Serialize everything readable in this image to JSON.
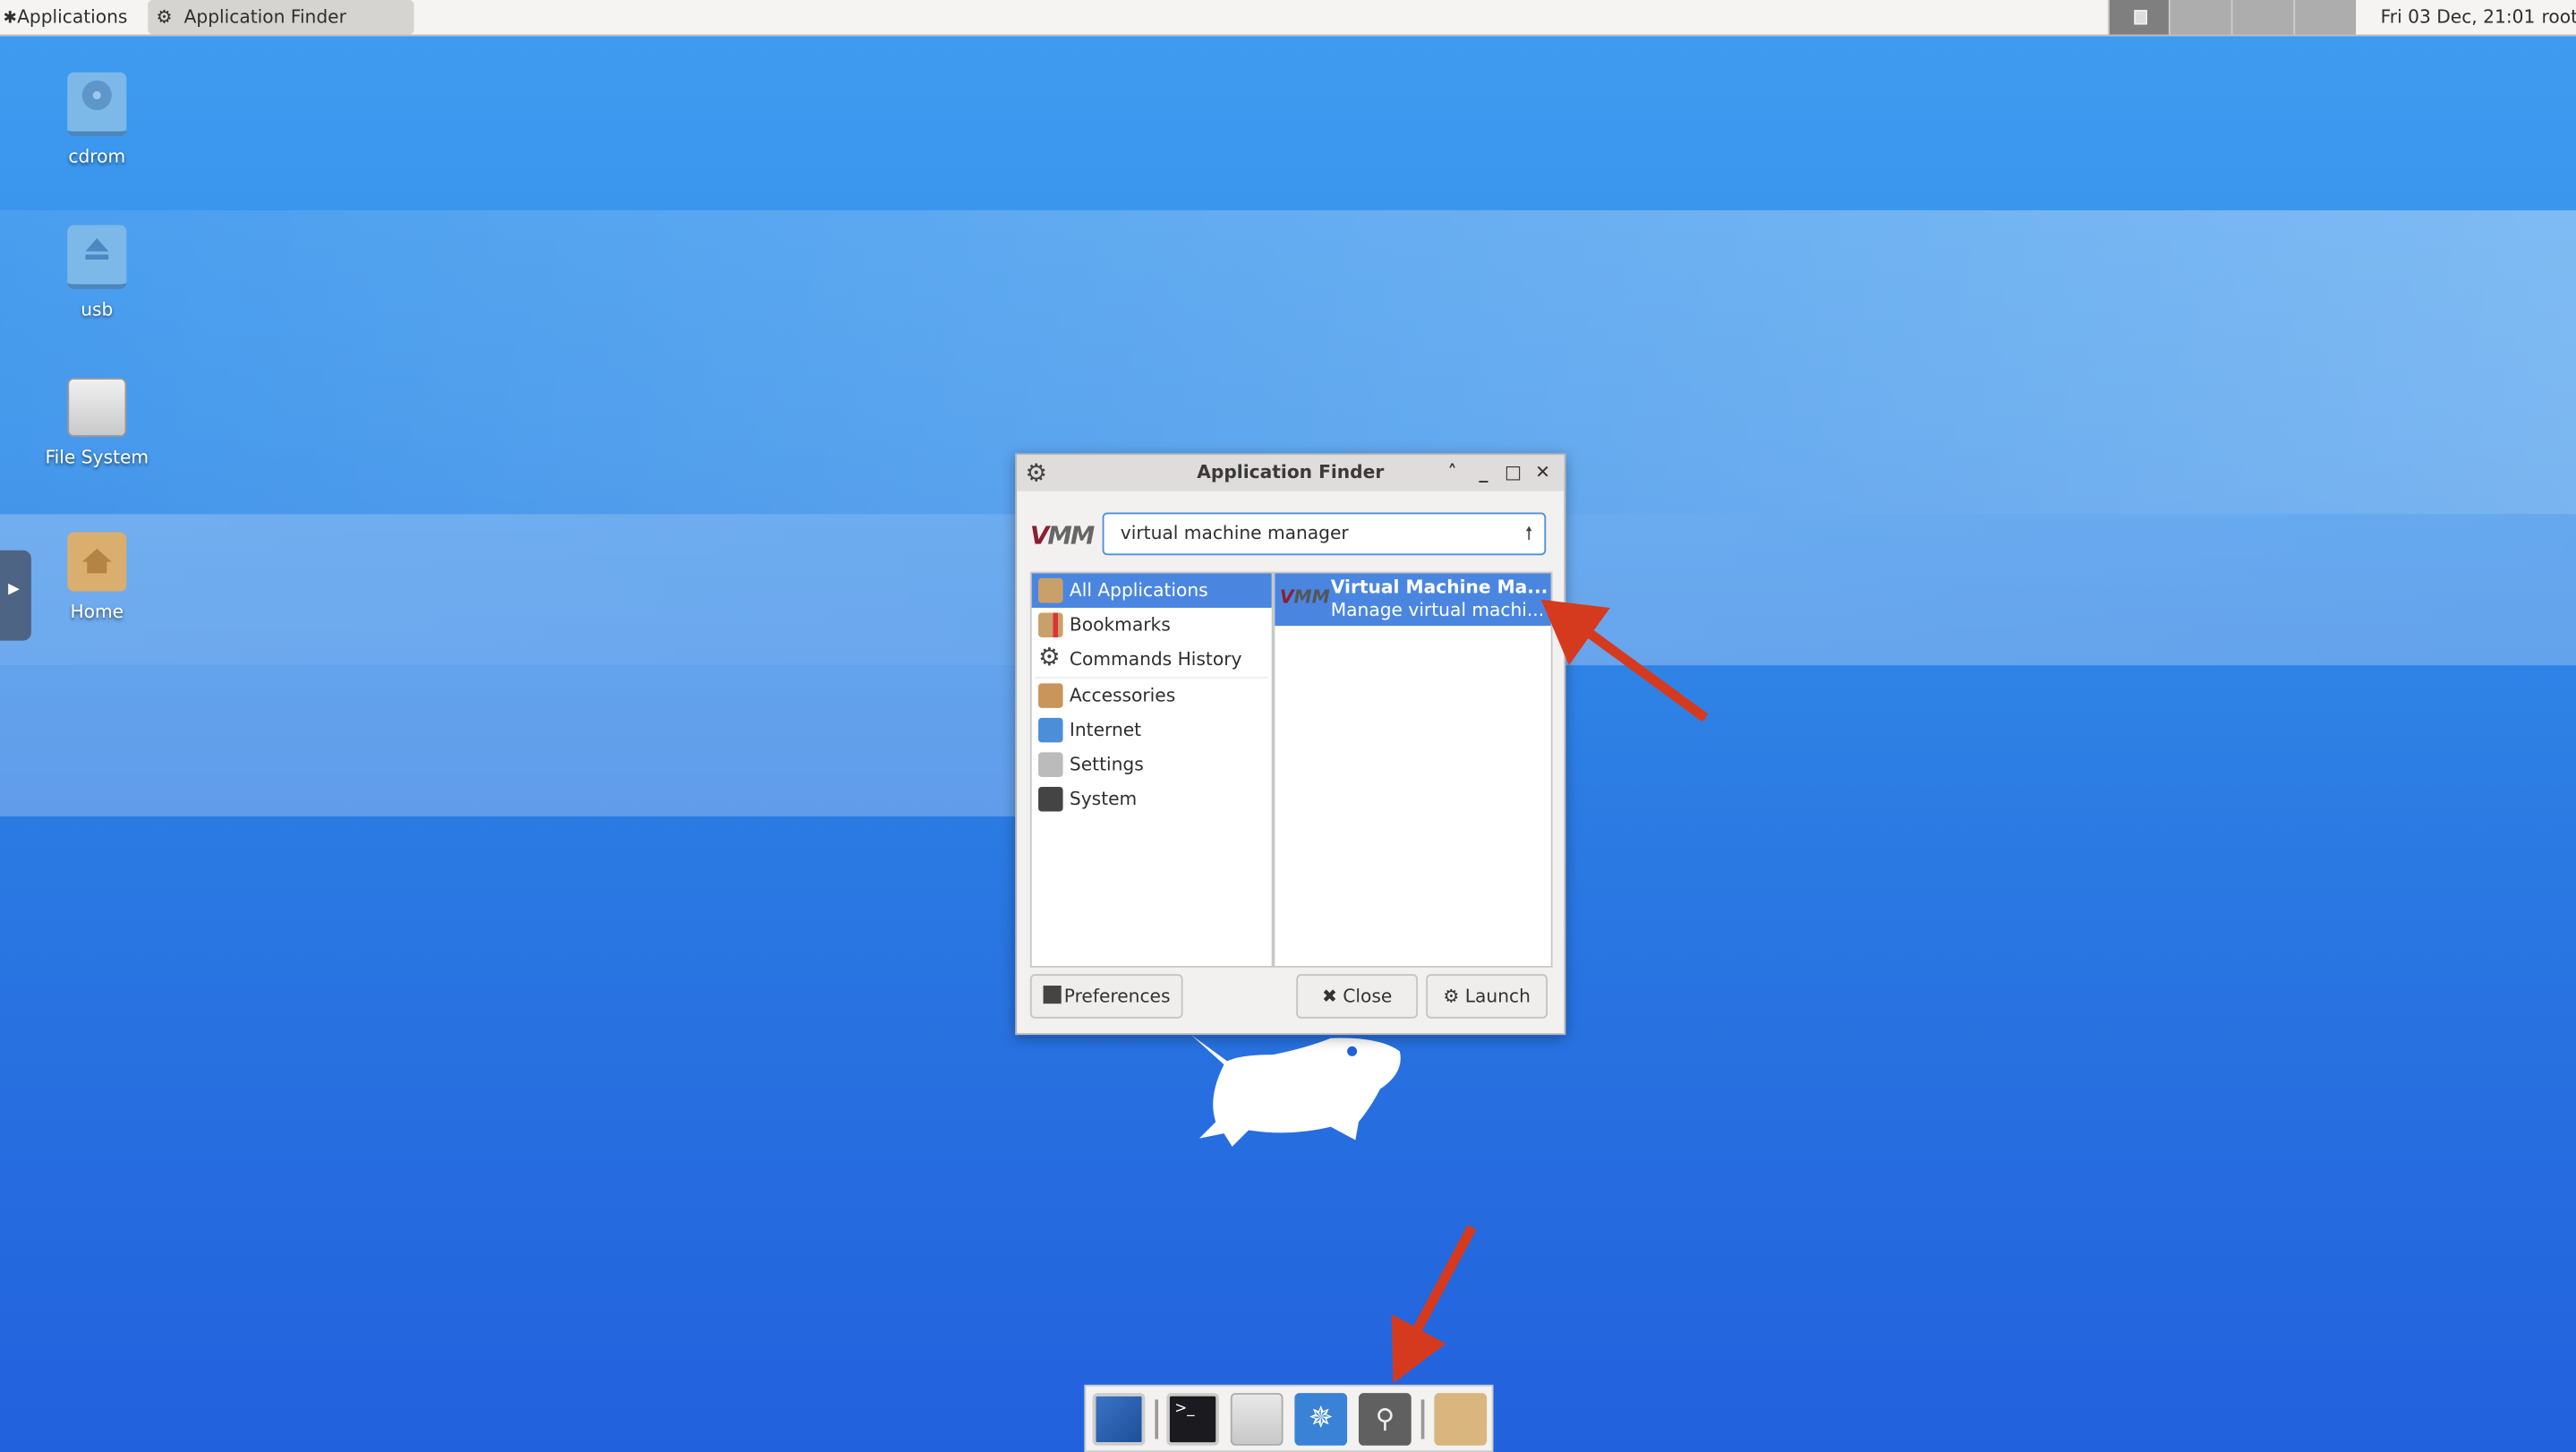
{
  "topbar": {
    "applications_label": "Applications",
    "task_label": "Application Finder",
    "clock": "Fri 03 Dec, 21:01",
    "user": "root"
  },
  "desktop": {
    "icons": [
      {
        "label": "cdrom",
        "icon": "cdrom-icon"
      },
      {
        "label": "usb",
        "icon": "usb-drive-icon"
      },
      {
        "label": "File System",
        "icon": "hard-drive-icon"
      },
      {
        "label": "Home",
        "icon": "home-folder-icon"
      }
    ]
  },
  "dialog": {
    "title": "Application Finder",
    "search_value": "virtual machine manager",
    "categories": [
      {
        "label": "All Applications",
        "selected": true
      },
      {
        "label": "Bookmarks"
      },
      {
        "label": "Commands History"
      },
      {
        "label": "Accessories"
      },
      {
        "label": "Internet"
      },
      {
        "label": "Settings"
      },
      {
        "label": "System"
      }
    ],
    "results": [
      {
        "name": "Virtual Machine Ma...",
        "description": "Manage virtual machi..."
      }
    ],
    "buttons": {
      "preferences": "Preferences",
      "close": "Close",
      "launch": "Launch"
    }
  },
  "dock": {
    "items": [
      "settings-manager",
      "terminal",
      "file-cabinet",
      "web-browser",
      "app-finder",
      "folder"
    ]
  },
  "colors": {
    "accent": "#4a86e0",
    "annotation": "#d63a1e"
  }
}
